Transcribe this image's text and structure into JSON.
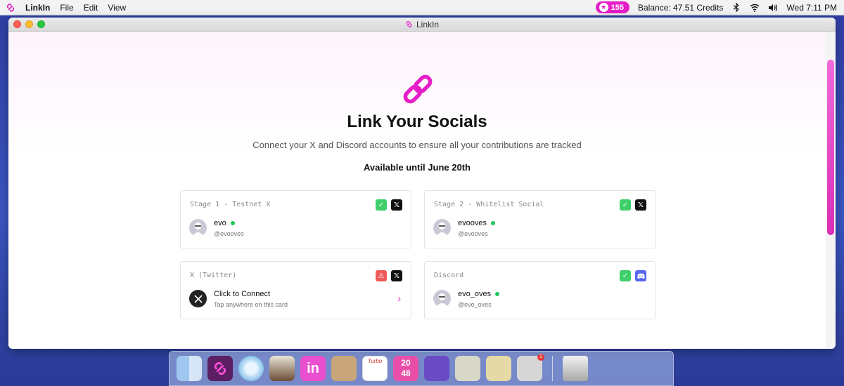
{
  "menubar": {
    "app_name": "LinkIn",
    "menus": [
      "File",
      "Edit",
      "View"
    ],
    "points": "155",
    "balance": "Balance:  47.51 Credits",
    "clock": "Wed 7:11 PM"
  },
  "window": {
    "title": "LinkIn"
  },
  "page": {
    "heading": "Link Your Socials",
    "subtitle": "Connect your X and Discord accounts to ensure all your contributions are tracked",
    "availability": "Available until June 20th"
  },
  "cards": [
    {
      "label": "Stage 1 - Testnet X",
      "name": "evo",
      "handle": "@evooves",
      "status": "connected"
    },
    {
      "label": "Stage 2 - Whitelist Social",
      "name": "evooves",
      "handle": "@evooves",
      "status": "connected"
    },
    {
      "label": "X (Twitter)",
      "name": "Click to Connect",
      "handle": "Tap anywhere on this card",
      "status": "warning"
    },
    {
      "label": "Discord",
      "name": "evo_oves",
      "handle": "@evo_oves",
      "status": "connected"
    }
  ],
  "dock": {
    "turbo_label": "Turbo",
    "game_label_top": "20",
    "game_label_bottom": "48",
    "notification_count": "1"
  },
  "colors": {
    "accent": "#e61ec8",
    "success": "#3ecf6b",
    "danger": "#ee5a5a",
    "discord": "#5865f2"
  },
  "icons": [
    "link-chain-icon",
    "check-icon",
    "warning-icon",
    "x-logo-icon",
    "discord-icon",
    "chevron-right-icon",
    "star-icon",
    "bluetooth-icon",
    "wifi-icon",
    "volume-icon"
  ]
}
